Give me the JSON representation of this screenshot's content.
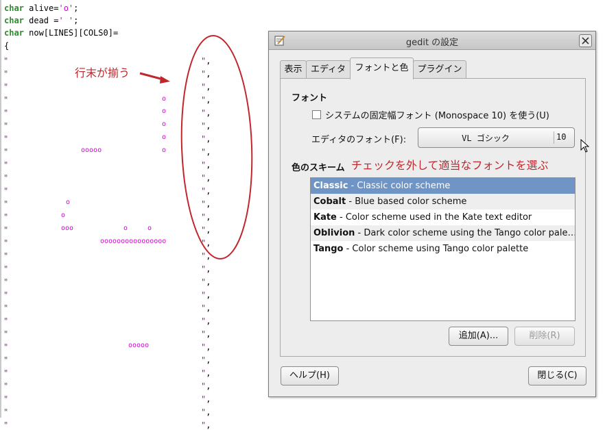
{
  "editor": {
    "line1_kw": "char",
    "line1_text": " alive=",
    "line1_str": "'o'",
    "line1_end": ";",
    "line2_kw": "char",
    "line2_text": " dead =",
    "line2_str": "' '",
    "line2_end": ";",
    "line3_kw": "char",
    "line3_text": " now[LINES][COLS0]=",
    "line4_text": "{",
    "quote": "\"",
    "quote_end": "\"",
    "comma": ",",
    "cells": {
      "c1": "o",
      "c2": "o",
      "c3": "o",
      "c4": "o",
      "c5a": "ooooo",
      "c5b": "o",
      "c6": "o",
      "c7": "o",
      "c8a": "ooo",
      "c8b": "o",
      "c8c": "o",
      "c9": "oooooooooooooooo",
      "c10": "ooooo"
    }
  },
  "annotations": {
    "aligned_label": "行末が揃う",
    "uncheck_label": "チェックを外して適当なフォントを選ぶ",
    "color": "#c0272d"
  },
  "dialog": {
    "title": "gedit の設定",
    "tabs": [
      "表示",
      "エディタ",
      "フォントと色",
      "プラグイン"
    ],
    "active_tab": "フォントと色",
    "font_section_title": "フォント",
    "checkbox_label": "システムの固定幅フォント (Monospace 10) を使う(U)",
    "checkbox_checked": false,
    "editor_font_label": "エディタのフォント(F):",
    "font_name": "VL ゴシック",
    "font_size": "10",
    "scheme_section_title": "色のスキーム",
    "schemes": [
      {
        "name": "Classic",
        "desc": " - Classic color scheme",
        "selected": true
      },
      {
        "name": "Cobalt",
        "desc": " - Blue based color scheme",
        "selected": false
      },
      {
        "name": "Kate",
        "desc": " - Color scheme used in the Kate text editor",
        "selected": false
      },
      {
        "name": "Oblivion",
        "desc": " - Dark color scheme using the Tango color pale…",
        "selected": false
      },
      {
        "name": "Tango",
        "desc": " - Color scheme using Tango color palette",
        "selected": false
      }
    ],
    "add_button": "追加(A)...",
    "remove_button": "削除(R)",
    "help_button": "ヘルプ(H)",
    "close_button": "閉じる(C)",
    "selection_color": "#6f95c6"
  }
}
